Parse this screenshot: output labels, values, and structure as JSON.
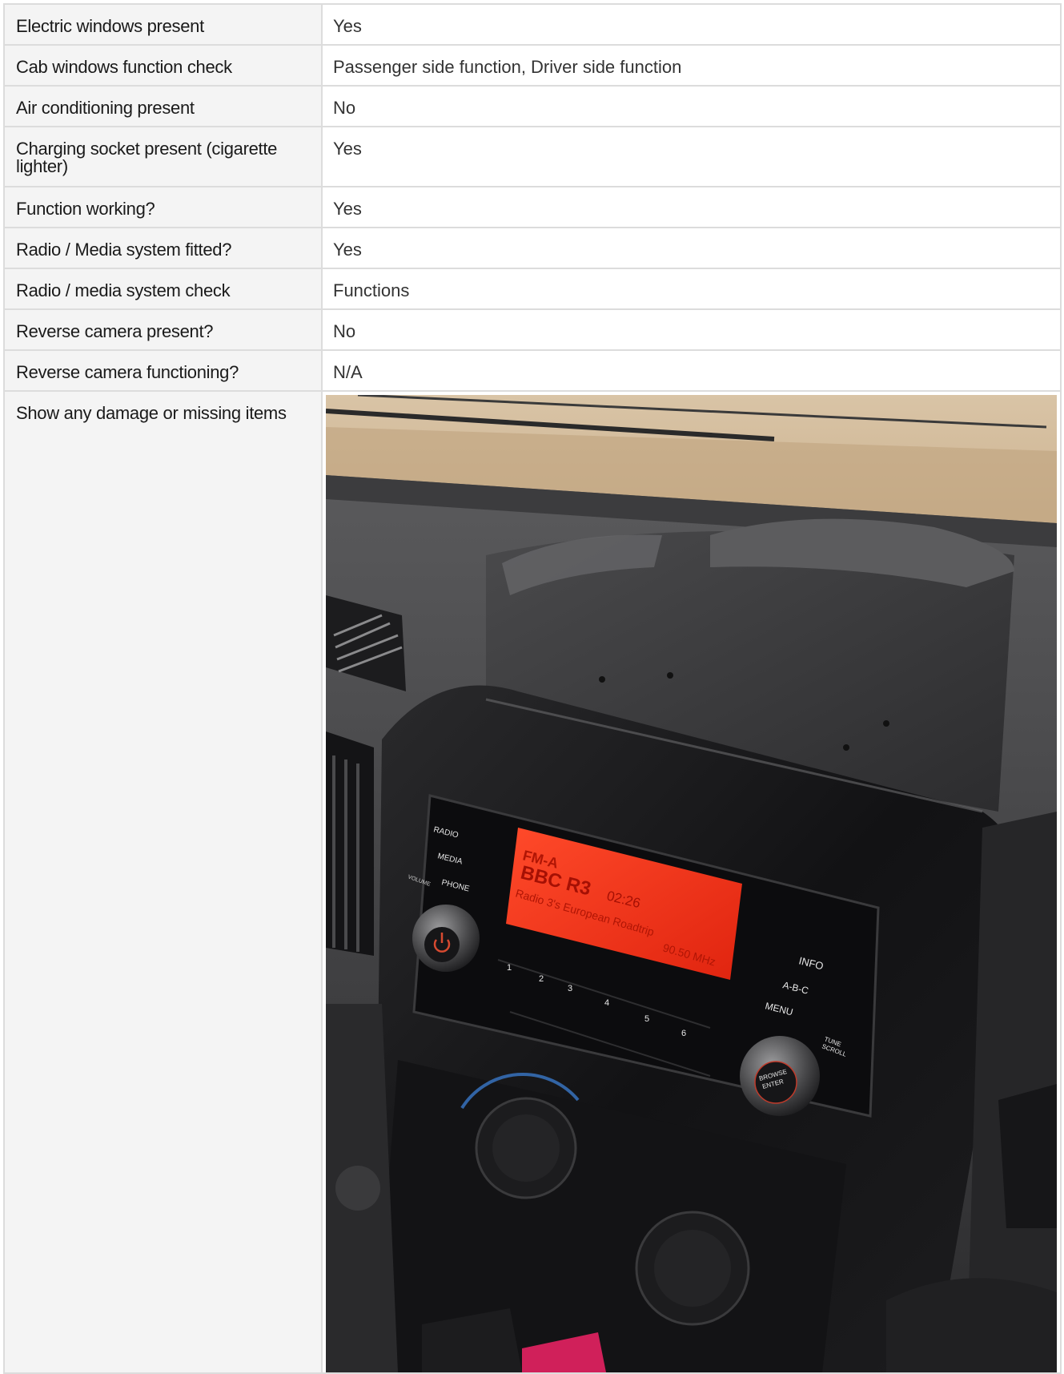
{
  "rows": [
    {
      "label": "Electric windows present",
      "value": "Yes"
    },
    {
      "label": "Cab windows function check",
      "value": "Passenger side function, Driver side function"
    },
    {
      "label": "Air conditioning present",
      "value": "No"
    },
    {
      "label": "Charging socket present (cigarette lighter)",
      "value": "Yes"
    },
    {
      "label": "Function working?",
      "value": "Yes"
    },
    {
      "label": "Radio / Media system fitted?",
      "value": "Yes"
    },
    {
      "label": "Radio / media system check",
      "value": "Functions"
    },
    {
      "label": "Reverse camera present?",
      "value": "No"
    },
    {
      "label": "Reverse camera functioning?",
      "value": "N/A"
    }
  ],
  "photo_row": {
    "label": "Show any damage or missing items"
  },
  "photo": {
    "display": {
      "band": "FM-A",
      "station": "BBC R3",
      "time": "02:26",
      "rds_text": "Radio 3's European Roadtrip",
      "frequency": "90.50 MHz"
    },
    "buttons": {
      "radio": "RADIO",
      "media": "MEDIA",
      "phone": "PHONE",
      "volume": "VOLUME",
      "info": "INFO",
      "abc": "A-B-C",
      "menu": "MENU",
      "tune_scroll_1": "TUNE",
      "tune_scroll_2": "SCROLL",
      "browse_1": "BROWSE",
      "browse_2": "ENTER",
      "presets": [
        "1",
        "2",
        "3",
        "4",
        "5",
        "6"
      ]
    }
  }
}
